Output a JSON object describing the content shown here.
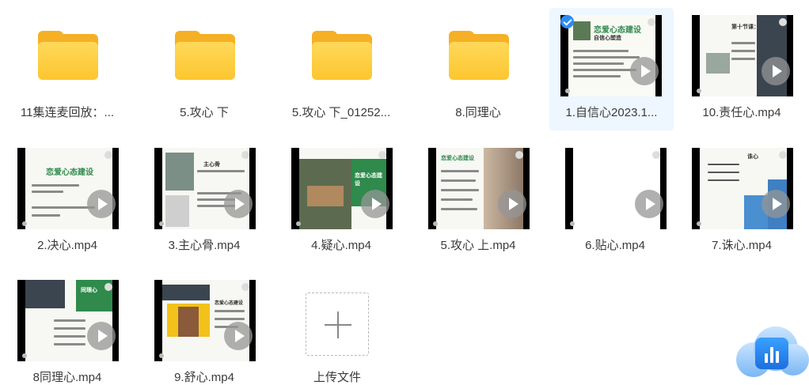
{
  "items": [
    {
      "name": "11集连麦回放：...",
      "kind": "folder",
      "selected": false
    },
    {
      "name": "5.攻心 下",
      "kind": "folder",
      "selected": false
    },
    {
      "name": "5.攻心 下_01252...",
      "kind": "folder",
      "selected": false
    },
    {
      "name": "8.同理心",
      "kind": "folder",
      "selected": false
    },
    {
      "name": "1.自信心2023.1...",
      "kind": "video",
      "selected": true,
      "thumb_title": "恋爱心态建设",
      "thumb_subtitle": "自信心塑造"
    },
    {
      "name": "10.责任心.mp4",
      "kind": "video",
      "selected": false,
      "thumb_title": "第十节课：责任心"
    },
    {
      "name": "2.决心.mp4",
      "kind": "video",
      "selected": false,
      "thumb_title": "恋爱心态建设"
    },
    {
      "name": "3.主心骨.mp4",
      "kind": "video",
      "selected": false,
      "thumb_title": "主心骨"
    },
    {
      "name": "4.疑心.mp4",
      "kind": "video",
      "selected": false,
      "thumb_title": "恋爱心态建设"
    },
    {
      "name": "5.攻心 上.mp4",
      "kind": "video",
      "selected": false,
      "thumb_title": "恋爱心态建设"
    },
    {
      "name": "6.贴心.mp4",
      "kind": "video",
      "selected": false,
      "thumb_title": ""
    },
    {
      "name": "7.诛心.mp4",
      "kind": "video",
      "selected": false,
      "thumb_title": "诛心"
    },
    {
      "name": "8同理心.mp4",
      "kind": "video",
      "selected": false,
      "thumb_title": "同理心"
    },
    {
      "name": "9.舒心.mp4",
      "kind": "video",
      "selected": false,
      "thumb_title": "恋爱心态建设"
    }
  ],
  "upload": {
    "label": "上传文件"
  },
  "colors": {
    "folder": "#fcc62f",
    "selected_bg": "#eef6ff",
    "check": "#2b8cf0",
    "thumb_green": "#2f8a4c"
  },
  "icons": {
    "folder": "folder-icon",
    "play": "play-icon",
    "check": "checkmark-icon",
    "upload": "plus-icon"
  }
}
